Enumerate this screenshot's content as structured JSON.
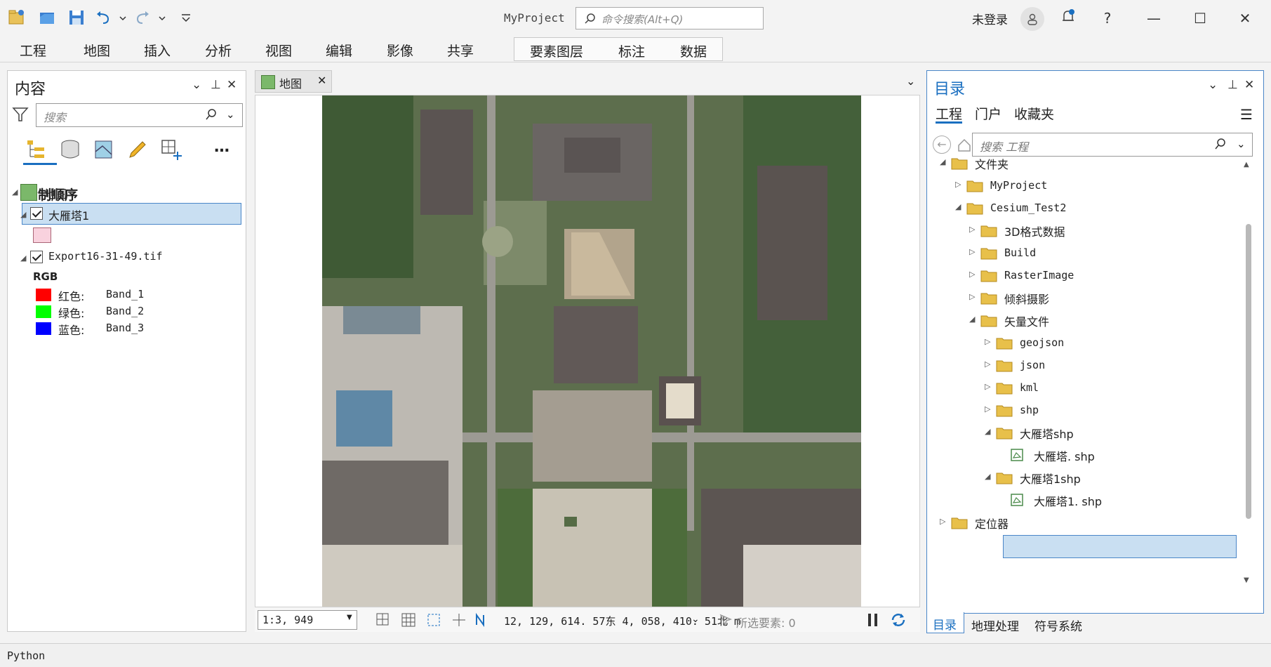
{
  "titlebar": {
    "app_title": "MyProject",
    "command_search_placeholder": "命令搜索(Alt+Q)",
    "login_status": "未登录",
    "icons": [
      "new-project-icon",
      "open-project-icon",
      "save-project-icon",
      "undo-icon",
      "redo-icon",
      "customize-icon",
      "user-icon",
      "notification-icon",
      "help-icon",
      "minimize-icon",
      "maximize-icon",
      "close-icon"
    ]
  },
  "ribbon": {
    "tabs": [
      "工程",
      "地图",
      "插入",
      "分析",
      "视图",
      "编辑",
      "影像",
      "共享"
    ],
    "contextual_tabs": [
      "要素图层",
      "标注",
      "数据"
    ]
  },
  "contents": {
    "title": "内容",
    "search_placeholder": "搜索",
    "drawing_order": "绘制顺序",
    "map_name": "地图",
    "layer1": "大雁塔1",
    "layer2": "Export16-31-49.tif",
    "rgb_label": "RGB",
    "bands": [
      {
        "label": "红色:",
        "band": "Band_1",
        "color": "#ff0000"
      },
      {
        "label": "绿色:",
        "band": "Band_2",
        "color": "#00ff00"
      },
      {
        "label": "蓝色:",
        "band": "Band_3",
        "color": "#0000ff"
      }
    ],
    "polygon_symbol_color": "#f9d2de"
  },
  "mapview": {
    "tab_label": "地图",
    "scale": "1:3, 949",
    "coordinates": "12, 129, 614. 57东  4, 058, 410. 51北  m",
    "selected_features": "所选要素: 0"
  },
  "catalog": {
    "title": "目录",
    "tabs": [
      "工程",
      "门户",
      "收藏夹"
    ],
    "search_placeholder": "搜索 工程",
    "tree": [
      {
        "label": "文件夹",
        "level": 0,
        "expanded": true
      },
      {
        "label": "MyProject",
        "level": 1,
        "expanded": false,
        "mono": true
      },
      {
        "label": "Cesium_Test2",
        "level": 1,
        "expanded": true,
        "mono": true
      },
      {
        "label": "3D格式数据",
        "level": 2,
        "expanded": false
      },
      {
        "label": "Build",
        "level": 2,
        "expanded": false,
        "mono": true
      },
      {
        "label": "RasterImage",
        "level": 2,
        "expanded": false,
        "mono": true
      },
      {
        "label": "倾斜摄影",
        "level": 2,
        "expanded": false
      },
      {
        "label": "矢量文件",
        "level": 2,
        "expanded": true
      },
      {
        "label": "geojson",
        "level": 3,
        "expanded": false,
        "mono": true
      },
      {
        "label": "json",
        "level": 3,
        "expanded": false,
        "mono": true
      },
      {
        "label": "kml",
        "level": 3,
        "expanded": false,
        "mono": true
      },
      {
        "label": "shp",
        "level": 3,
        "expanded": false,
        "mono": true
      },
      {
        "label": "大雁塔shp",
        "level": 3,
        "expanded": true
      },
      {
        "label": "大雁塔. shp",
        "level": 4,
        "file": true
      },
      {
        "label": "大雁塔1shp",
        "level": 3,
        "expanded": true,
        "selected": true
      },
      {
        "label": "大雁塔1. shp",
        "level": 4,
        "file": true
      },
      {
        "label": "定位器",
        "level": 0,
        "expanded": false
      }
    ],
    "bottom_tabs": [
      "目录",
      "地理处理",
      "符号系统"
    ]
  },
  "python_bar": {
    "label": "Python"
  },
  "colors": {
    "accent": "#1a6fc0",
    "selection": "#c9dff2",
    "folder": "#e8c04a"
  }
}
